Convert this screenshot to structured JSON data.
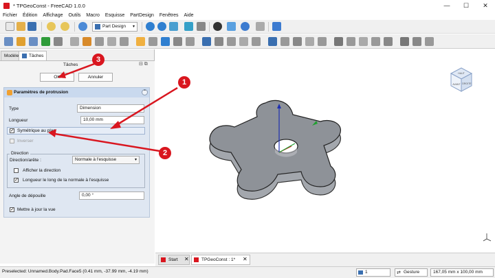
{
  "window": {
    "title": "* TPGeoConst - FreeCAD 1.0.0",
    "min": "—",
    "max": "☐",
    "close": "✕"
  },
  "menu": [
    "Fichier",
    "Édition",
    "Affichage",
    "Outils",
    "Macro",
    "Esquisse",
    "PartDesign",
    "Fenêtres",
    "Aide"
  ],
  "toolbar": {
    "workbench": "Part Design"
  },
  "panel": {
    "tabs": [
      "Modèle",
      "Tâches"
    ],
    "header": "Tâches",
    "ok": "OK",
    "cancel": "Annuler",
    "section_title": "Paramètres de protrusion",
    "type_label": "Type",
    "type_value": "Dimension",
    "length_label": "Longueur",
    "length_value": "10,00 mm",
    "symmetric_label": "Symétrique au plan",
    "symmetric_checked": true,
    "reverse_label": "Inverser",
    "reverse_checked": false,
    "direction_group": "Direction",
    "direction_edge_label": "Direction/arête :",
    "direction_edge_value": "Normale à l'esquisse",
    "show_direction_label": "Afficher la direction",
    "show_direction_checked": false,
    "length_along_label": "Longueur le long de la normale à l'esquisse",
    "length_along_checked": true,
    "taper_label": "Angle de dépouille",
    "taper_value": "0,00 °",
    "update_view_label": "Mettre à jour la vue",
    "update_view_checked": true
  },
  "callouts": [
    "1",
    "2",
    "3"
  ],
  "navcube": {
    "top": "HAUT",
    "front": "AVANT",
    "right": "DROITE"
  },
  "doc_tabs": [
    "Start",
    "TPGeoConst : 1*"
  ],
  "status": {
    "text": "Preselected: Unnamed.Body.Pad.Face5 (0.41 mm, -37.99 mm, -4.19 mm)",
    "page": "1",
    "nav": "Gesture",
    "dims": "167,05 mm x 100,00 mm"
  },
  "colors": {
    "accent": "#d9161f",
    "panel_header": "#c9d9ee",
    "solid": "#8e9298"
  }
}
